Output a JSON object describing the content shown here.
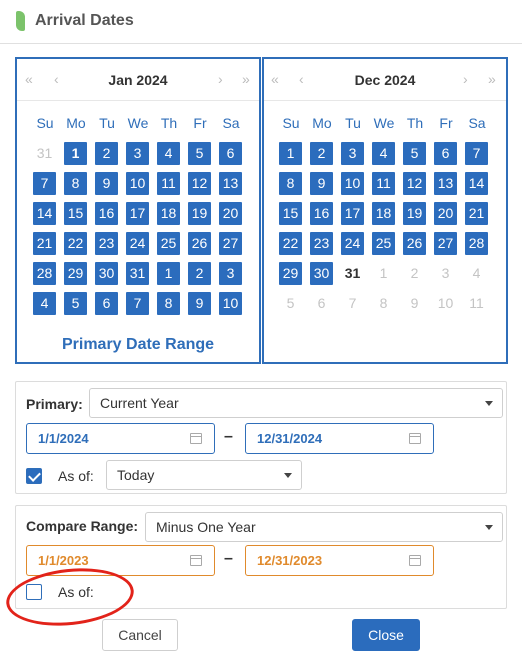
{
  "header": {
    "title": "Arrival Dates",
    "icon": "leaf-icon",
    "accent": "#7cc36b"
  },
  "nav_glyphs": {
    "prev_year": "«",
    "prev_month": "‹",
    "next_month": "›",
    "next_year": "»"
  },
  "weekdays": [
    "Su",
    "Mo",
    "Tu",
    "We",
    "Th",
    "Fr",
    "Sa"
  ],
  "calendar_left": {
    "month": "Jan 2024",
    "range_label": "Primary Date Range",
    "weeks": [
      [
        {
          "d": "31",
          "s": "muted"
        },
        {
          "d": "1",
          "s": "sel-bold"
        },
        {
          "d": "2",
          "s": "sel"
        },
        {
          "d": "3",
          "s": "sel"
        },
        {
          "d": "4",
          "s": "sel"
        },
        {
          "d": "5",
          "s": "sel"
        },
        {
          "d": "6",
          "s": "sel"
        }
      ],
      [
        {
          "d": "7",
          "s": "sel"
        },
        {
          "d": "8",
          "s": "sel"
        },
        {
          "d": "9",
          "s": "sel"
        },
        {
          "d": "10",
          "s": "sel"
        },
        {
          "d": "11",
          "s": "sel"
        },
        {
          "d": "12",
          "s": "sel"
        },
        {
          "d": "13",
          "s": "sel"
        }
      ],
      [
        {
          "d": "14",
          "s": "sel"
        },
        {
          "d": "15",
          "s": "sel"
        },
        {
          "d": "16",
          "s": "sel"
        },
        {
          "d": "17",
          "s": "sel"
        },
        {
          "d": "18",
          "s": "sel"
        },
        {
          "d": "19",
          "s": "sel"
        },
        {
          "d": "20",
          "s": "sel"
        }
      ],
      [
        {
          "d": "21",
          "s": "sel"
        },
        {
          "d": "22",
          "s": "sel"
        },
        {
          "d": "23",
          "s": "sel"
        },
        {
          "d": "24",
          "s": "sel"
        },
        {
          "d": "25",
          "s": "sel"
        },
        {
          "d": "26",
          "s": "sel"
        },
        {
          "d": "27",
          "s": "sel"
        }
      ],
      [
        {
          "d": "28",
          "s": "sel"
        },
        {
          "d": "29",
          "s": "sel"
        },
        {
          "d": "30",
          "s": "sel"
        },
        {
          "d": "31",
          "s": "sel"
        },
        {
          "d": "1",
          "s": "sel"
        },
        {
          "d": "2",
          "s": "sel"
        },
        {
          "d": "3",
          "s": "sel"
        }
      ],
      [
        {
          "d": "4",
          "s": "sel"
        },
        {
          "d": "5",
          "s": "sel"
        },
        {
          "d": "6",
          "s": "sel"
        },
        {
          "d": "7",
          "s": "sel"
        },
        {
          "d": "8",
          "s": "sel"
        },
        {
          "d": "9",
          "s": "sel"
        },
        {
          "d": "10",
          "s": "sel"
        }
      ]
    ]
  },
  "calendar_right": {
    "month": "Dec 2024",
    "weeks": [
      [
        {
          "d": "1",
          "s": "sel"
        },
        {
          "d": "2",
          "s": "sel"
        },
        {
          "d": "3",
          "s": "sel"
        },
        {
          "d": "4",
          "s": "sel"
        },
        {
          "d": "5",
          "s": "sel"
        },
        {
          "d": "6",
          "s": "sel"
        },
        {
          "d": "7",
          "s": "sel"
        }
      ],
      [
        {
          "d": "8",
          "s": "sel"
        },
        {
          "d": "9",
          "s": "sel"
        },
        {
          "d": "10",
          "s": "sel"
        },
        {
          "d": "11",
          "s": "sel"
        },
        {
          "d": "12",
          "s": "sel"
        },
        {
          "d": "13",
          "s": "sel"
        },
        {
          "d": "14",
          "s": "sel"
        }
      ],
      [
        {
          "d": "15",
          "s": "sel"
        },
        {
          "d": "16",
          "s": "sel"
        },
        {
          "d": "17",
          "s": "sel"
        },
        {
          "d": "18",
          "s": "sel"
        },
        {
          "d": "19",
          "s": "sel"
        },
        {
          "d": "20",
          "s": "sel"
        },
        {
          "d": "21",
          "s": "sel"
        }
      ],
      [
        {
          "d": "22",
          "s": "sel"
        },
        {
          "d": "23",
          "s": "sel"
        },
        {
          "d": "24",
          "s": "sel"
        },
        {
          "d": "25",
          "s": "sel"
        },
        {
          "d": "26",
          "s": "sel"
        },
        {
          "d": "27",
          "s": "sel"
        },
        {
          "d": "28",
          "s": "sel"
        }
      ],
      [
        {
          "d": "29",
          "s": "sel"
        },
        {
          "d": "30",
          "s": "sel"
        },
        {
          "d": "31",
          "s": "bold"
        },
        {
          "d": "1",
          "s": "muted"
        },
        {
          "d": "2",
          "s": "muted"
        },
        {
          "d": "3",
          "s": "muted"
        },
        {
          "d": "4",
          "s": "muted"
        }
      ],
      [
        {
          "d": "5",
          "s": "muted"
        },
        {
          "d": "6",
          "s": "muted"
        },
        {
          "d": "7",
          "s": "muted"
        },
        {
          "d": "8",
          "s": "muted"
        },
        {
          "d": "9",
          "s": "muted"
        },
        {
          "d": "10",
          "s": "muted"
        },
        {
          "d": "11",
          "s": "muted"
        }
      ]
    ]
  },
  "primary": {
    "label": "Primary:",
    "select_value": "Current Year",
    "start": "1/1/2024",
    "end": "12/31/2024",
    "as_of_checked": true,
    "as_of_label": "As of:",
    "as_of_value": "Today"
  },
  "compare": {
    "label": "Compare Range:",
    "select_value": "Minus One Year",
    "start": "1/1/2023",
    "end": "12/31/2023",
    "as_of_checked": false,
    "as_of_label": "As of:"
  },
  "separator": "–",
  "buttons": {
    "cancel": "Cancel",
    "close": "Close"
  },
  "colors": {
    "primary_blue": "#2b6cbd",
    "compare_orange": "#e08a2c",
    "annotation_red": "#e2231a"
  }
}
